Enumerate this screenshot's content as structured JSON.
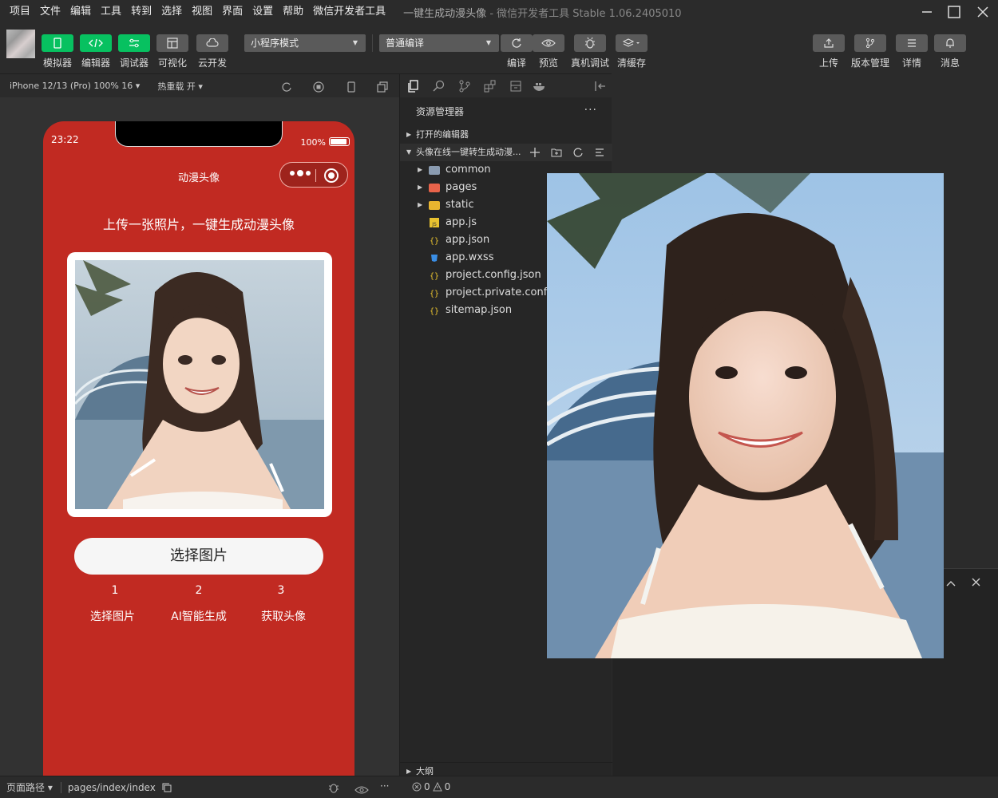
{
  "menubar": {
    "items": [
      "项目",
      "文件",
      "编辑",
      "工具",
      "转到",
      "选择",
      "视图",
      "界面",
      "设置",
      "帮助",
      "微信开发者工具"
    ],
    "title": "一键生成动漫头像",
    "subtitle": "- 微信开发者工具 Stable 1.06.2405010"
  },
  "toolbar": {
    "left_buttons": [
      {
        "label": "模拟器",
        "icon": "phone-icon"
      },
      {
        "label": "编辑器",
        "icon": "code-icon"
      },
      {
        "label": "调试器",
        "icon": "sliders-icon"
      },
      {
        "label": "可视化",
        "icon": "layout-icon"
      },
      {
        "label": "云开发",
        "icon": "cloud-icon"
      }
    ],
    "mode_select": "小程序模式",
    "compile_select": "普通编译",
    "mid_buttons": [
      {
        "label": "编译",
        "icon": "refresh-icon"
      },
      {
        "label": "预览",
        "icon": "eye-icon"
      },
      {
        "label": "真机调试",
        "icon": "bug-icon"
      },
      {
        "label": "清缓存",
        "icon": "layers-icon"
      }
    ],
    "right_buttons": [
      {
        "label": "上传",
        "icon": "upload-icon"
      },
      {
        "label": "版本管理",
        "icon": "branch-icon"
      },
      {
        "label": "详情",
        "icon": "menu-icon"
      },
      {
        "label": "消息",
        "icon": "bell-icon"
      }
    ]
  },
  "devicebar": {
    "device": "iPhone 12/13 (Pro) 100% 16",
    "hotreload": "热重载 开"
  },
  "phone": {
    "time": "23:22",
    "battery": "100%",
    "nav_title": "动漫头像",
    "subtitle": "上传一张照片，一键生成动漫头像",
    "select_button": "选择图片",
    "steps": [
      {
        "num": "1",
        "label": "选择图片"
      },
      {
        "num": "2",
        "label": "AI智能生成"
      },
      {
        "num": "3",
        "label": "获取头像"
      }
    ]
  },
  "explorer": {
    "header": "资源管理器",
    "more": "···",
    "open_editors": "打开的编辑器",
    "project": "头像在线一键转生成动漫...",
    "files": [
      {
        "name": "common",
        "type": "folder",
        "color": "#8a9bb0"
      },
      {
        "name": "pages",
        "type": "folder",
        "color": "#e8634a"
      },
      {
        "name": "static",
        "type": "folder",
        "color": "#e8b52f"
      },
      {
        "name": "app.js",
        "type": "js"
      },
      {
        "name": "app.json",
        "type": "json"
      },
      {
        "name": "app.wxss",
        "type": "css"
      },
      {
        "name": "project.config.json",
        "type": "json"
      },
      {
        "name": "project.private.config.json",
        "type": "json"
      },
      {
        "name": "sitemap.json",
        "type": "json"
      }
    ],
    "outline": "大纲"
  },
  "statusbar": {
    "page_path_label": "页面路径",
    "page_path": "pages/index/index",
    "errors": "0",
    "warnings": "0"
  },
  "colors": {
    "phone_bg": "#c12a22",
    "accent_green": "#07c160"
  }
}
